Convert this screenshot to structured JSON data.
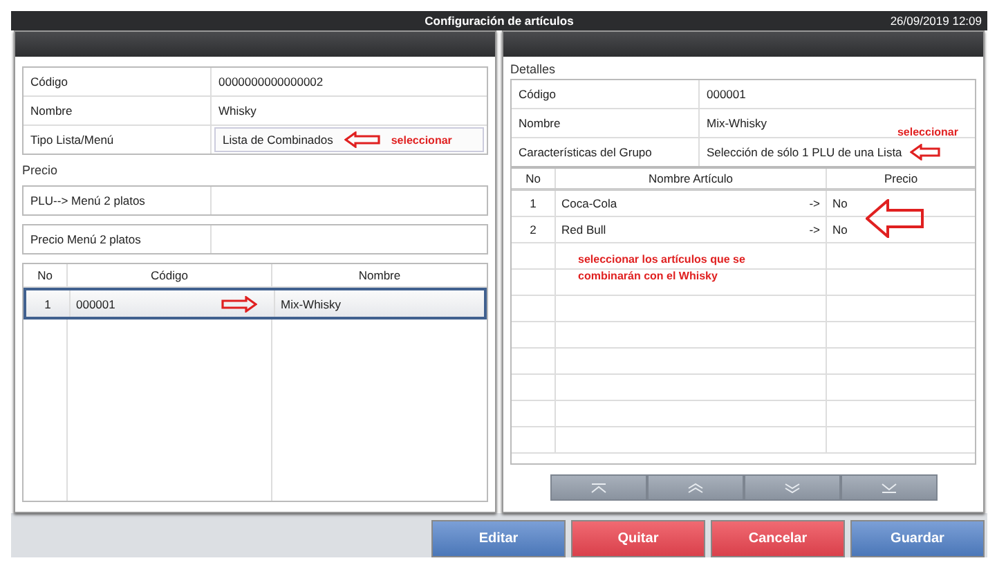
{
  "title_bar": {
    "title": "Configuración de artículos",
    "datetime": "26/09/2019 12:09"
  },
  "left_panel": {
    "fields": [
      {
        "label": "Código",
        "value": "0000000000000002",
        "kind": "text"
      },
      {
        "label": "Nombre",
        "value": "Whisky",
        "kind": "text"
      },
      {
        "label": "Tipo Lista/Menú",
        "value": "Lista de Combinados",
        "kind": "select",
        "annotation": "seleccionar"
      }
    ],
    "section_label": "Precio",
    "price_fields": [
      {
        "label": "PLU--> Menú 2 platos"
      },
      {
        "label": "Precio Menú 2 platos"
      }
    ],
    "grid": {
      "columns": [
        "No",
        "Código",
        "Nombre"
      ],
      "rows": [
        {
          "cells": [
            "1",
            "000001",
            "Mix-Whisky"
          ],
          "selected": true
        }
      ]
    }
  },
  "right_panel": {
    "section_label": "Detalles",
    "fields": [
      {
        "label": "Código",
        "value": "000001"
      },
      {
        "label": "Nombre",
        "value": "Mix-Whisky"
      },
      {
        "label": "Características del Grupo",
        "value": "Selección de sólo 1 PLU de una Lista",
        "annotation": "seleccionar"
      }
    ],
    "grid": {
      "columns": [
        "No",
        "Nombre Artículo",
        "Precio"
      ],
      "rows": [
        {
          "no": "1",
          "name": "Coca-Cola",
          "arrow": "->",
          "price": "No"
        },
        {
          "no": "2",
          "name": "Red Bull",
          "arrow": "->",
          "price": "No"
        }
      ],
      "annotation": "seleccionar los artículos que se combinarán con el Whisky"
    }
  },
  "buttons": [
    {
      "label": "Editar",
      "kind": "primary"
    },
    {
      "label": "Quitar",
      "kind": "danger"
    },
    {
      "label": "Cancelar",
      "kind": "danger"
    },
    {
      "label": "Guardar",
      "kind": "primary"
    }
  ]
}
